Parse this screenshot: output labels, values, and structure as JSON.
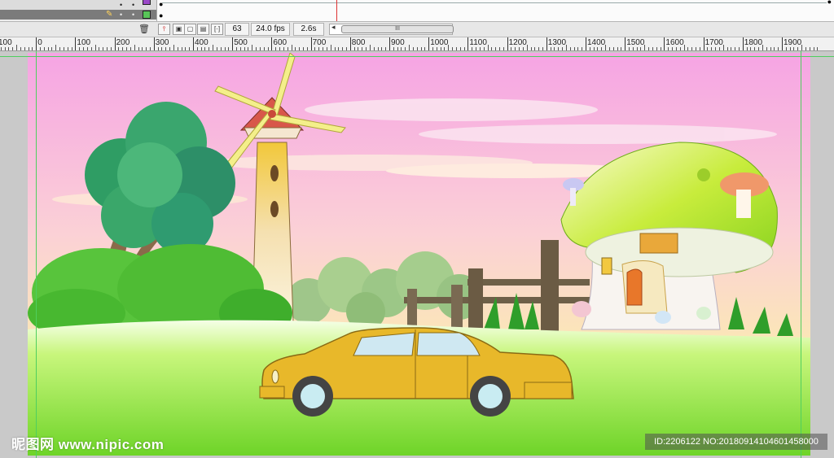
{
  "timeline": {
    "frame_number": "63",
    "fps": "24.0 fps",
    "elapsed": "2.6s",
    "scroll_thumb": "III",
    "scroll_arrow": "◂"
  },
  "ruler": {
    "labels": [
      "100",
      "0",
      "100",
      "200",
      "300",
      "400",
      "500",
      "600",
      "700",
      "800",
      "900",
      "1000",
      "1100",
      "1200",
      "1300",
      "1400",
      "1500",
      "1600",
      "1700",
      "1800",
      "1900"
    ]
  },
  "watermark": {
    "site_cn": "昵图网",
    "site_url": "www.nipic.com",
    "id_text": "ID:2206122 NO:20180914104601458000"
  },
  "colors": {
    "sky_top": "#f6a9e6",
    "sky_bottom": "#fbe5b0",
    "grass": "#86e23a",
    "car": "#e8b82a",
    "guide": "#4fcf5e",
    "playhead": "#dd3333"
  }
}
